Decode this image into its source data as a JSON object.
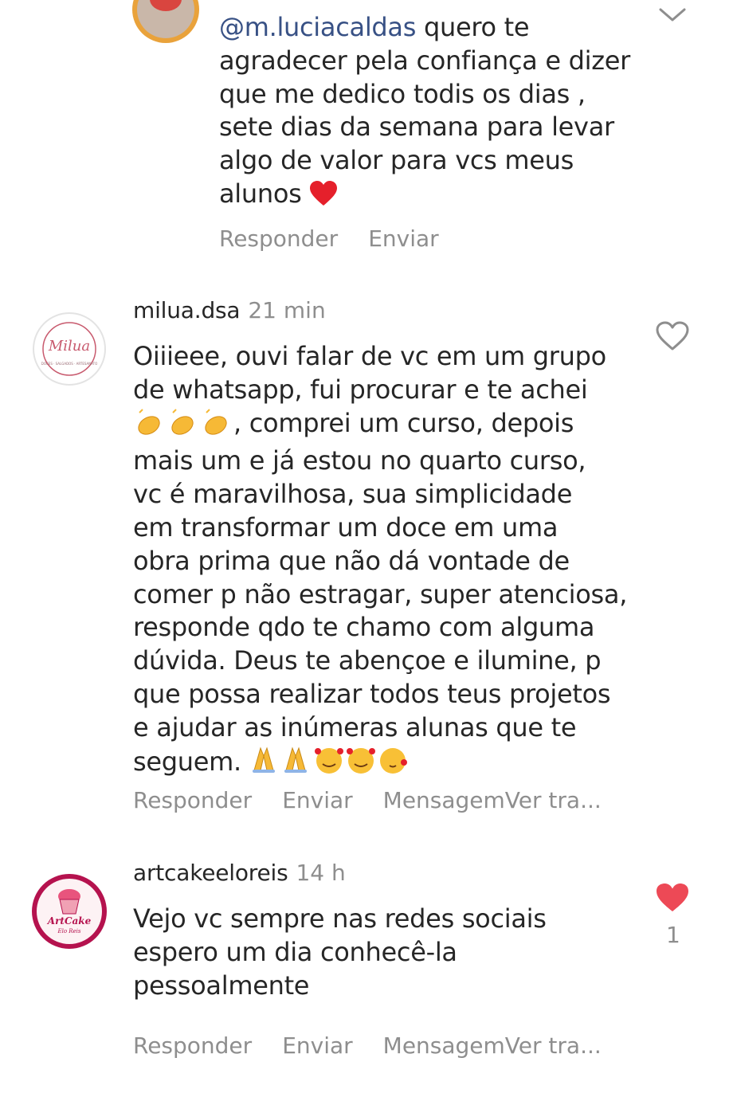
{
  "reply": {
    "mention": "@m.luciacaldas",
    "lines": [
      " quero te",
      "agradecer pela confiança e dizer",
      "que me dedico todis os dias ,",
      "sete dias da semana para levar",
      "algo de valor para vcs meus",
      "alunos "
    ],
    "reply_label": "Responder",
    "send_label": "Enviar"
  },
  "comments": [
    {
      "username": "milua.dsa",
      "time": "21 min",
      "avatar_text": "Milua",
      "avatar_subtext": "DOCES · SALGADOS · ARTESANATO",
      "lines": [
        "Oiiieee, ouvi falar de vc em um grupo",
        "de whatsapp, fui procurar e te achei",
        ", comprei um curso, depois",
        "mais um e já estou no quarto curso,",
        "vc é maravilhosa, sua simplicidade",
        "em transformar um doce em uma",
        "obra prima que não dá vontade de",
        "comer p não estragar, super atenciosa,",
        "responde qdo te chamo com alguma",
        "dúvida. Deus te abençoe e ilumine, p",
        "que possa realizar todos teus projetos",
        "e ajudar as inúmeras alunas que te",
        "seguem. "
      ],
      "reply_label": "Responder",
      "send_label": "Enviar",
      "message_label": "MensagemVer tra..."
    },
    {
      "username": "artcakeeloreis",
      "time": "14 h",
      "avatar_text": "ArtCake",
      "avatar_subtext": "Elo Reis",
      "lines": [
        "Vejo vc sempre nas redes sociais",
        "espero um dia conhecê-la",
        "pessoalmente"
      ],
      "likes": "1",
      "reply_label": "Responder",
      "send_label": "Enviar",
      "message_label": "MensagemVer tra..."
    }
  ],
  "colors": {
    "heart_red": "#ed4956",
    "muted": "#8e8e8e",
    "mention": "#385185",
    "artcake_ring": "#b5124e"
  }
}
